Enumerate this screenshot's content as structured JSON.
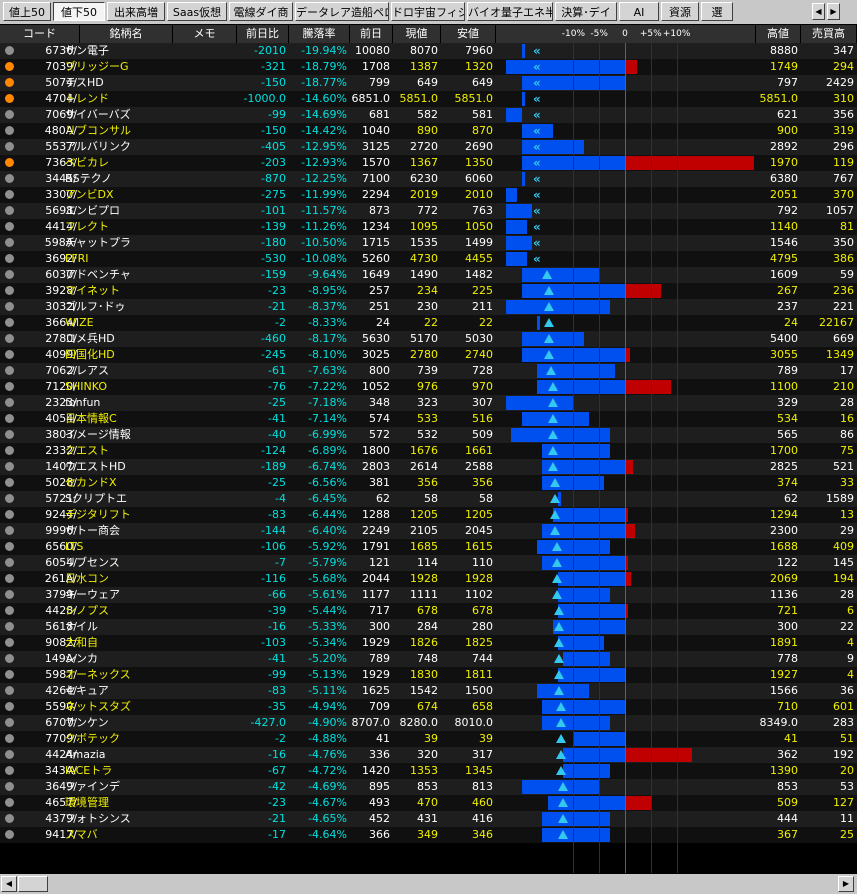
{
  "tabs": [
    {
      "label": "値上50",
      "active": false
    },
    {
      "label": "値下50",
      "active": true
    },
    {
      "label": "出来高増",
      "active": false
    },
    {
      "label": "Saas仮想",
      "active": false
    },
    {
      "label": "電線ダイ商",
      "active": false
    },
    {
      "label": "データレア造船ペロ銀行",
      "active": false
    },
    {
      "label": "ドロ宇宙フィジAI",
      "active": false
    },
    {
      "label": "バイオ量子エネ半導",
      "active": false
    },
    {
      "label": "決算･デイ",
      "active": false
    },
    {
      "label": "AI",
      "active": false
    },
    {
      "label": "資源",
      "active": false
    },
    {
      "label": "選",
      "active": false
    }
  ],
  "tab_scroll": {
    "left": "◀",
    "right": "▶"
  },
  "columns": {
    "code": "コード",
    "name": "銘柄名",
    "memo": "メモ",
    "change": "前日比",
    "change_pct": "騰落率",
    "prev": "前日",
    "price": "現値",
    "low": "安値",
    "bar_ticks": [
      "-10%",
      "-5%",
      "0",
      "+5%",
      "+10%"
    ],
    "high": "高値",
    "trade_high": "売買高"
  },
  "colors": {
    "bar_blue": "#0050f0",
    "bar_red": "#c00000",
    "marker": "#33c8f0",
    "yellow_name": "#f0f000",
    "white_name": "#ffffff",
    "change_cyan": "#00e0e0",
    "dot_orange": "#ff8800",
    "dot_gray": "#909090"
  },
  "rows": [
    {
      "code": "6736/",
      "name": "サン電子",
      "hl": false,
      "dot": "gray",
      "change": "-2010",
      "pct": "-19.94%",
      "prev": "10080",
      "price": "8070",
      "low": "7960",
      "high": "8880",
      "vol": "347",
      "blue": [
        -0.2,
        -0.2
      ],
      "red": null,
      "marker": -0.2
    },
    {
      "code": "7039/",
      "name": "ブリッジーG",
      "hl": true,
      "dot": "orange",
      "change": "-321",
      "pct": "-18.79%",
      "prev": "1708",
      "price": "1387",
      "low": "1320",
      "high": "1749",
      "vol": "294",
      "blue": [
        -0.23,
        0.0
      ],
      "red": [
        0.0,
        0.024
      ],
      "marker": -0.19
    },
    {
      "code": "5074/",
      "name": "テスHD",
      "hl": false,
      "dot": "orange",
      "change": "-150",
      "pct": "-18.77%",
      "prev": "799",
      "price": "649",
      "low": "649",
      "high": "797",
      "vol": "2429",
      "blue": [
        -0.2,
        0.0
      ],
      "red": null,
      "marker": -0.19
    },
    {
      "code": "4704/",
      "name": "トレンド",
      "hl": true,
      "dot": "orange",
      "change": "-1000.0",
      "pct": "-14.60%",
      "prev": "6851.0",
      "price": "5851.0",
      "low": "5851.0",
      "high": "5851.0",
      "vol": "310",
      "blue": [
        -0.2,
        -0.2
      ],
      "red": null,
      "marker": -0.19
    },
    {
      "code": "7069/",
      "name": "サイバーバズ",
      "hl": false,
      "dot": "gray",
      "change": "-99",
      "pct": "-14.69%",
      "prev": "681",
      "price": "582",
      "low": "581",
      "high": "621",
      "vol": "356",
      "blue": [
        -0.23,
        -0.2
      ],
      "red": null,
      "marker": -0.19
    },
    {
      "code": "480A/",
      "name": "リブコンサル",
      "hl": true,
      "dot": "gray",
      "change": "-150",
      "pct": "-14.42%",
      "prev": "1040",
      "price": "890",
      "low": "870",
      "high": "900",
      "vol": "319",
      "blue": [
        -0.2,
        -0.14
      ],
      "red": null,
      "marker": -0.19
    },
    {
      "code": "5537/",
      "name": "アルバリンク",
      "hl": false,
      "dot": "gray",
      "change": "-405",
      "pct": "-12.95%",
      "prev": "3125",
      "price": "2720",
      "low": "2690",
      "high": "2892",
      "vol": "296",
      "blue": [
        -0.2,
        -0.08
      ],
      "red": null,
      "marker": -0.19
    },
    {
      "code": "7363/",
      "name": "ベビカレ",
      "hl": true,
      "dot": "orange",
      "change": "-203",
      "pct": "-12.93%",
      "prev": "1570",
      "price": "1367",
      "low": "1350",
      "high": "1970",
      "vol": "119",
      "blue": [
        -0.2,
        0.0
      ],
      "red": [
        0.0,
        0.25
      ],
      "marker": -0.19
    },
    {
      "code": "3445/",
      "name": "RSテクノ",
      "hl": false,
      "dot": "gray",
      "change": "-870",
      "pct": "-12.25%",
      "prev": "7100",
      "price": "6230",
      "low": "6060",
      "high": "6380",
      "vol": "767",
      "blue": [
        -0.2,
        -0.2
      ],
      "red": null,
      "marker": -0.19
    },
    {
      "code": "3300/",
      "name": "アンビDX",
      "hl": true,
      "dot": "gray",
      "change": "-275",
      "pct": "-11.99%",
      "prev": "2294",
      "price": "2019",
      "low": "2010",
      "high": "2051",
      "vol": "370",
      "blue": [
        -0.23,
        -0.21
      ],
      "red": null,
      "marker": -0.19
    },
    {
      "code": "5698/",
      "name": "エンビプロ",
      "hl": false,
      "dot": "gray",
      "change": "-101",
      "pct": "-11.57%",
      "prev": "873",
      "price": "772",
      "low": "763",
      "high": "792",
      "vol": "1057",
      "blue": [
        -0.23,
        -0.18
      ],
      "red": null,
      "marker": -0.19
    },
    {
      "code": "4414/",
      "name": "フレクト",
      "hl": true,
      "dot": "gray",
      "change": "-139",
      "pct": "-11.26%",
      "prev": "1234",
      "price": "1095",
      "low": "1050",
      "high": "1140",
      "vol": "81",
      "blue": [
        -0.23,
        -0.19
      ],
      "red": null,
      "marker": -0.19
    },
    {
      "code": "598A/",
      "name": "チャットプラ",
      "hl": false,
      "dot": "gray",
      "change": "-180",
      "pct": "-10.50%",
      "prev": "1715",
      "price": "1535",
      "low": "1499",
      "high": "1546",
      "vol": "350",
      "blue": [
        -0.23,
        -0.18
      ],
      "red": null,
      "marker": -0.19
    },
    {
      "code": "3692/",
      "name": "FFRI",
      "hl": true,
      "dot": "gray",
      "change": "-530",
      "pct": "-10.08%",
      "prev": "5260",
      "price": "4730",
      "low": "4455",
      "high": "4795",
      "vol": "386",
      "blue": [
        -0.23,
        -0.19
      ],
      "red": null,
      "marker": -0.19
    },
    {
      "code": "6030/",
      "name": "アドベンチャ",
      "hl": false,
      "dot": "gray",
      "change": "-159",
      "pct": "-9.64%",
      "prev": "1649",
      "price": "1490",
      "low": "1482",
      "high": "1609",
      "vol": "59",
      "blue": [
        -0.2,
        -0.05
      ],
      "red": null,
      "marker": -0.18
    },
    {
      "code": "3928/",
      "name": "マイネット",
      "hl": true,
      "dot": "gray",
      "change": "-23",
      "pct": "-8.95%",
      "prev": "257",
      "price": "234",
      "low": "225",
      "high": "267",
      "vab": "",
      "vol": "236",
      "blue": [
        -0.2,
        0.0
      ],
      "red": [
        0.0,
        0.07
      ],
      "marker": -0.17
    },
    {
      "code": "3032/",
      "name": "ゴルフ･ドゥ",
      "hl": false,
      "dot": "gray",
      "change": "-21",
      "pct": "-8.37%",
      "prev": "251",
      "price": "230",
      "low": "211",
      "high": "237",
      "vol": "221",
      "blue": [
        -0.23,
        -0.03
      ],
      "red": null,
      "marker": -0.17
    },
    {
      "code": "3664/",
      "name": "WIZE",
      "hl": true,
      "dot": "gray",
      "change": "-2",
      "pct": "-8.33%",
      "prev": "24",
      "price": "22",
      "low": "22",
      "high": "24",
      "vol": "22167",
      "blue": [
        -0.17,
        -0.17
      ],
      "red": null,
      "marker": -0.17
    },
    {
      "code": "2780/",
      "name": "コメ兵HD",
      "hl": false,
      "dot": "gray",
      "change": "-460",
      "pct": "-8.17%",
      "prev": "5630",
      "price": "5170",
      "low": "5030",
      "high": "5400",
      "vol": "669",
      "blue": [
        -0.2,
        -0.08
      ],
      "red": null,
      "marker": -0.17
    },
    {
      "code": "4099/",
      "name": "四国化HD",
      "hl": true,
      "dot": "gray",
      "change": "-245",
      "pct": "-8.10%",
      "prev": "3025",
      "price": "2780",
      "low": "2740",
      "high": "3055",
      "vol": "1349",
      "blue": [
        -0.2,
        0.0
      ],
      "red": [
        0.0,
        0.01
      ],
      "marker": -0.17
    },
    {
      "code": "7062/",
      "name": "フレアス",
      "hl": false,
      "dot": "gray",
      "change": "-61",
      "pct": "-7.63%",
      "prev": "800",
      "price": "739",
      "low": "728",
      "high": "789",
      "vol": "17",
      "blue": [
        -0.17,
        -0.02
      ],
      "red": null,
      "marker": -0.16
    },
    {
      "code": "7120/",
      "name": "SHINKO",
      "hl": true,
      "dot": "gray",
      "change": "-76",
      "pct": "-7.22%",
      "prev": "1052",
      "price": "976",
      "low": "970",
      "high": "1100",
      "vol": "210",
      "blue": [
        -0.17,
        0.0
      ],
      "red": [
        0.0,
        0.09
      ],
      "marker": -0.15
    },
    {
      "code": "2323/",
      "name": "fonfun",
      "hl": false,
      "dot": "gray",
      "change": "-25",
      "pct": "-7.18%",
      "prev": "348",
      "price": "323",
      "low": "307",
      "high": "329",
      "vol": "28",
      "blue": [
        -0.23,
        -0.1
      ],
      "red": null,
      "marker": -0.15
    },
    {
      "code": "4054/",
      "name": "日本情報C",
      "hl": true,
      "dot": "gray",
      "change": "-41",
      "pct": "-7.14%",
      "prev": "574",
      "price": "533",
      "low": "516",
      "high": "534",
      "vol": "16",
      "blue": [
        -0.2,
        -0.07
      ],
      "red": null,
      "marker": -0.15
    },
    {
      "code": "3803/",
      "name": "イメージ情報",
      "hl": false,
      "dot": "gray",
      "change": "-40",
      "pct": "-6.99%",
      "prev": "572",
      "price": "532",
      "low": "509",
      "high": "565",
      "vol": "86",
      "blue": [
        -0.22,
        -0.03
      ],
      "red": null,
      "marker": -0.15
    },
    {
      "code": "2332/",
      "name": "クエスト",
      "hl": true,
      "dot": "gray",
      "change": "-124",
      "pct": "-6.89%",
      "prev": "1800",
      "price": "1676",
      "low": "1661",
      "high": "1700",
      "vol": "75",
      "blue": [
        -0.16,
        -0.03
      ],
      "red": null,
      "marker": -0.15
    },
    {
      "code": "1407/",
      "name": "ウエストHD",
      "hl": false,
      "dot": "gray",
      "change": "-189",
      "pct": "-6.74%",
      "prev": "2803",
      "price": "2614",
      "low": "2588",
      "high": "2825",
      "vol": "521",
      "blue": [
        -0.16,
        0.0
      ],
      "red": [
        0.0,
        0.015
      ],
      "marker": -0.15
    },
    {
      "code": "5028/",
      "name": "セカンドX",
      "hl": true,
      "dot": "gray",
      "change": "-25",
      "pct": "-6.56%",
      "prev": "381",
      "price": "356",
      "low": "356",
      "high": "374",
      "vol": "33",
      "blue": [
        -0.16,
        -0.04
      ],
      "red": null,
      "marker": -0.14
    },
    {
      "code": "5721/",
      "name": "Sクリプトエ",
      "hl": false,
      "dot": "gray",
      "change": "-4",
      "pct": "-6.45%",
      "prev": "62",
      "price": "58",
      "low": "58",
      "high": "62",
      "vol": "1589",
      "blue": [
        -0.13,
        -0.13
      ],
      "red": null,
      "marker": -0.14
    },
    {
      "code": "9244/",
      "name": "デジタリフト",
      "hl": true,
      "dot": "gray",
      "change": "-83",
      "pct": "-6.44%",
      "prev": "1288",
      "price": "1205",
      "low": "1205",
      "high": "1294",
      "vol": "13",
      "blue": [
        -0.14,
        0.0
      ],
      "red": [
        0.0,
        0.005
      ],
      "marker": -0.14
    },
    {
      "code": "9996/",
      "name": "サトー商会",
      "hl": false,
      "dot": "gray",
      "change": "-144",
      "pct": "-6.40%",
      "prev": "2249",
      "price": "2105",
      "low": "2045",
      "high": "2300",
      "vol": "29",
      "blue": [
        -0.16,
        0.0
      ],
      "red": [
        0.0,
        0.02
      ],
      "marker": -0.14
    },
    {
      "code": "6560/",
      "name": "LTS",
      "hl": true,
      "dot": "gray",
      "change": "-106",
      "pct": "-5.92%",
      "prev": "1791",
      "price": "1685",
      "low": "1615",
      "high": "1688",
      "vol": "409",
      "blue": [
        -0.17,
        -0.03
      ],
      "red": null,
      "marker": -0.13
    },
    {
      "code": "6054/",
      "name": "リブセンス",
      "hl": false,
      "dot": "gray",
      "change": "-7",
      "pct": "-5.79%",
      "prev": "121",
      "price": "114",
      "low": "110",
      "high": "122",
      "vol": "145",
      "blue": [
        -0.16,
        0.0
      ],
      "red": [
        0.0,
        0.005
      ],
      "marker": -0.13
    },
    {
      "code": "261A/",
      "name": "日水コン",
      "hl": true,
      "dot": "gray",
      "change": "-116",
      "pct": "-5.68%",
      "prev": "2044",
      "price": "1928",
      "low": "1928",
      "high": "2069",
      "vol": "194",
      "blue": [
        -0.13,
        0.0
      ],
      "red": [
        0.0,
        0.012
      ],
      "marker": -0.13
    },
    {
      "code": "3799/",
      "name": "キーウェア",
      "hl": false,
      "dot": "gray",
      "change": "-66",
      "pct": "-5.61%",
      "prev": "1177",
      "price": "1111",
      "low": "1102",
      "high": "1136",
      "vol": "28",
      "blue": [
        -0.13,
        -0.03
      ],
      "red": null,
      "marker": -0.13
    },
    {
      "code": "4428/",
      "name": "シノプス",
      "hl": true,
      "dot": "gray",
      "change": "-39",
      "pct": "-5.44%",
      "prev": "717",
      "price": "678",
      "low": "678",
      "high": "721",
      "vol": "6",
      "blue": [
        -0.13,
        0.0
      ],
      "red": [
        0.0,
        0.005
      ],
      "marker": -0.12
    },
    {
      "code": "5618/",
      "name": "ナイル",
      "hl": false,
      "dot": "gray",
      "change": "-16",
      "pct": "-5.33%",
      "prev": "300",
      "price": "284",
      "low": "280",
      "high": "300",
      "vol": "22",
      "blue": [
        -0.14,
        0.0
      ],
      "red": null,
      "marker": -0.12
    },
    {
      "code": "9082/",
      "name": "大和自",
      "hl": true,
      "dot": "gray",
      "change": "-103",
      "pct": "-5.34%",
      "prev": "1929",
      "price": "1826",
      "low": "1825",
      "high": "1891",
      "vol": "4",
      "blue": [
        -0.13,
        -0.04
      ],
      "red": null,
      "marker": -0.12
    },
    {
      "code": "149A/",
      "name": "シンカ",
      "hl": false,
      "dot": "gray",
      "change": "-41",
      "pct": "-5.20%",
      "prev": "789",
      "price": "748",
      "low": "744",
      "high": "778",
      "vol": "9",
      "blue": [
        -0.12,
        -0.03
      ],
      "red": null,
      "marker": -0.12
    },
    {
      "code": "5987/",
      "name": "オーネックス",
      "hl": true,
      "dot": "gray",
      "change": "-99",
      "pct": "-5.13%",
      "prev": "1929",
      "price": "1830",
      "low": "1811",
      "high": "1927",
      "vol": "4",
      "blue": [
        -0.13,
        0.0
      ],
      "red": null,
      "marker": -0.12
    },
    {
      "code": "4264/",
      "name": "セキュア",
      "hl": false,
      "dot": "gray",
      "change": "-83",
      "pct": "-5.11%",
      "prev": "1625",
      "price": "1542",
      "low": "1500",
      "high": "1566",
      "vol": "36",
      "blue": [
        -0.17,
        -0.07
      ],
      "red": null,
      "marker": -0.12
    },
    {
      "code": "5590/",
      "name": "ネットスタズ",
      "hl": true,
      "dot": "gray",
      "change": "-35",
      "pct": "-4.94%",
      "prev": "709",
      "price": "674",
      "low": "658",
      "high": "710",
      "vol": "601",
      "blue": [
        -0.16,
        0.0
      ],
      "red": null,
      "marker": -0.11
    },
    {
      "code": "6707/",
      "name": "サンケン",
      "hl": false,
      "dot": "gray",
      "change": "-427.0",
      "pct": "-4.90%",
      "prev": "8707.0",
      "price": "8280.0",
      "low": "8010.0",
      "high": "8349.0",
      "vol": "283",
      "blue": [
        -0.16,
        -0.03
      ],
      "red": null,
      "marker": -0.11
    },
    {
      "code": "7709/",
      "name": "クボテック",
      "hl": true,
      "dot": "gray",
      "change": "-2",
      "pct": "-4.88%",
      "prev": "41",
      "price": "39",
      "low": "39",
      "high": "41",
      "vol": "51",
      "blue": [
        -0.1,
        0.0
      ],
      "red": null,
      "marker": -0.11
    },
    {
      "code": "4424/",
      "name": "Amazia",
      "hl": false,
      "dot": "gray",
      "change": "-16",
      "pct": "-4.76%",
      "prev": "336",
      "price": "320",
      "low": "317",
      "high": "362",
      "vol": "192",
      "blue": [
        -0.12,
        0.0
      ],
      "red": [
        0.0,
        0.13
      ],
      "marker": -0.11
    },
    {
      "code": "343A/",
      "name": "IACEトラ",
      "hl": true,
      "dot": "gray",
      "change": "-67",
      "pct": "-4.72%",
      "prev": "1420",
      "price": "1353",
      "low": "1345",
      "high": "1390",
      "vol": "20",
      "blue": [
        -0.12,
        -0.03
      ],
      "red": null,
      "marker": -0.11
    },
    {
      "code": "3649/",
      "name": "ファインデ",
      "hl": false,
      "dot": "gray",
      "change": "-42",
      "pct": "-4.69%",
      "prev": "895",
      "price": "853",
      "low": "813",
      "high": "853",
      "vol": "53",
      "blue": [
        -0.2,
        -0.05
      ],
      "red": null,
      "marker": -0.1
    },
    {
      "code": "4657/",
      "name": "環境管理",
      "hl": true,
      "dot": "gray",
      "change": "-23",
      "pct": "-4.67%",
      "prev": "493",
      "price": "470",
      "low": "460",
      "high": "509",
      "vol": "127",
      "blue": [
        -0.15,
        0.0
      ],
      "red": [
        0.0,
        0.05
      ],
      "marker": -0.1
    },
    {
      "code": "4379/",
      "name": "フォトシンス",
      "hl": false,
      "dot": "gray",
      "change": "-21",
      "pct": "-4.65%",
      "prev": "452",
      "price": "431",
      "low": "416",
      "high": "444",
      "vol": "11",
      "blue": [
        -0.16,
        -0.03
      ],
      "red": null,
      "marker": -0.1
    },
    {
      "code": "9417/",
      "name": "スマバ",
      "hl": true,
      "dot": "gray",
      "change": "-17",
      "pct": "-4.64%",
      "prev": "366",
      "price": "349",
      "low": "346",
      "high": "367",
      "vol": "25",
      "blue": [
        -0.16,
        -0.03
      ],
      "red": null,
      "marker": -0.1
    }
  ],
  "scrollbar": {
    "left": "◀",
    "right": "▶"
  }
}
